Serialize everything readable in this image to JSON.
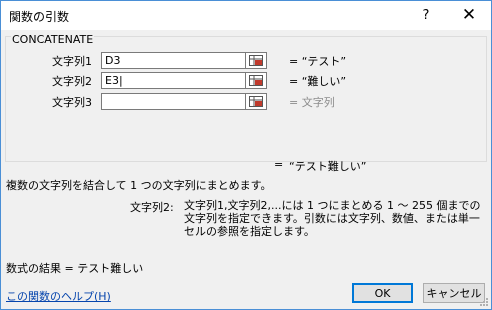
{
  "window": {
    "title": "関数の引数",
    "help_label": "?",
    "close_label": "✕"
  },
  "function": {
    "name": "CONCATENATE",
    "args": [
      {
        "label": "文字列1",
        "value": "D3",
        "result": "= “テスト”",
        "result_gray": false
      },
      {
        "label": "文字列2",
        "value": "E3|",
        "result": "= “難しい”",
        "result_gray": false
      },
      {
        "label": "文字列3",
        "value": "",
        "result": "= 文字列",
        "result_gray": true
      }
    ],
    "result_eq": "=",
    "result_value": "“テスト難しい”",
    "description": "複数の文字列を結合して 1 つの文字列にまとめます。",
    "arg_desc_label": "文字列2:",
    "arg_desc_text": "文字列1,文字列2,...には 1 つにまとめる 1 〜 255 個までの文字列を指定できます。引数には文字列、数値、または単一セルの参照を指定します。"
  },
  "footer": {
    "formula_result": "数式の結果 =  テスト難しい",
    "help_link": "この関数のヘルプ(H)",
    "ok_label": "OK",
    "cancel_label": "キャンセル"
  },
  "icons": {
    "ref_button": "range-select-icon",
    "close": "close-icon",
    "help": "help-icon"
  }
}
